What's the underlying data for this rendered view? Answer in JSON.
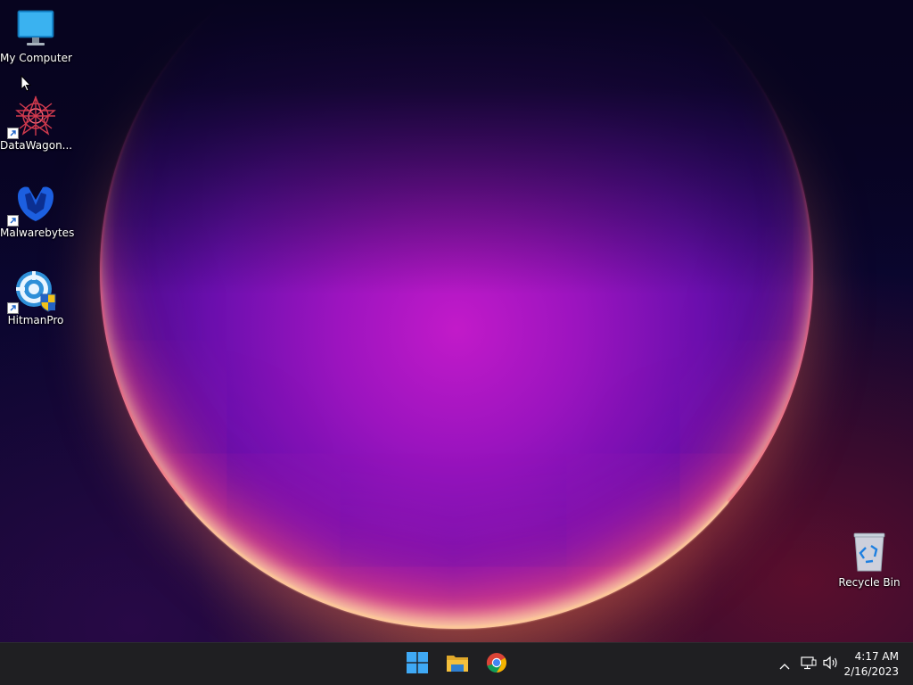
{
  "desktop": {
    "icons": [
      {
        "label": "My Computer",
        "icon": "monitor-icon"
      },
      {
        "label": "DataWagon...",
        "icon": "datawagon-icon"
      },
      {
        "label": "Malwarebytes",
        "icon": "malwarebytes-icon"
      },
      {
        "label": "HitmanPro",
        "icon": "hitmanpro-icon"
      },
      {
        "label": "Recycle Bin",
        "icon": "recycle-bin-icon"
      }
    ]
  },
  "taskbar": {
    "pinned": [
      {
        "name": "Start",
        "icon": "windows-start-icon"
      },
      {
        "name": "File Explorer",
        "icon": "folder-icon"
      },
      {
        "name": "Google Chrome",
        "icon": "chrome-icon"
      }
    ],
    "tray": {
      "icons": [
        "chevron-up-icon",
        "network-icon",
        "volume-icon"
      ],
      "time": "4:17 AM",
      "date": "2/16/2023"
    }
  },
  "colors": {
    "taskbar_bg": "#1f1f22",
    "windows_blue": "#3fa9f5",
    "folder_yellow": "#f5c03c"
  }
}
